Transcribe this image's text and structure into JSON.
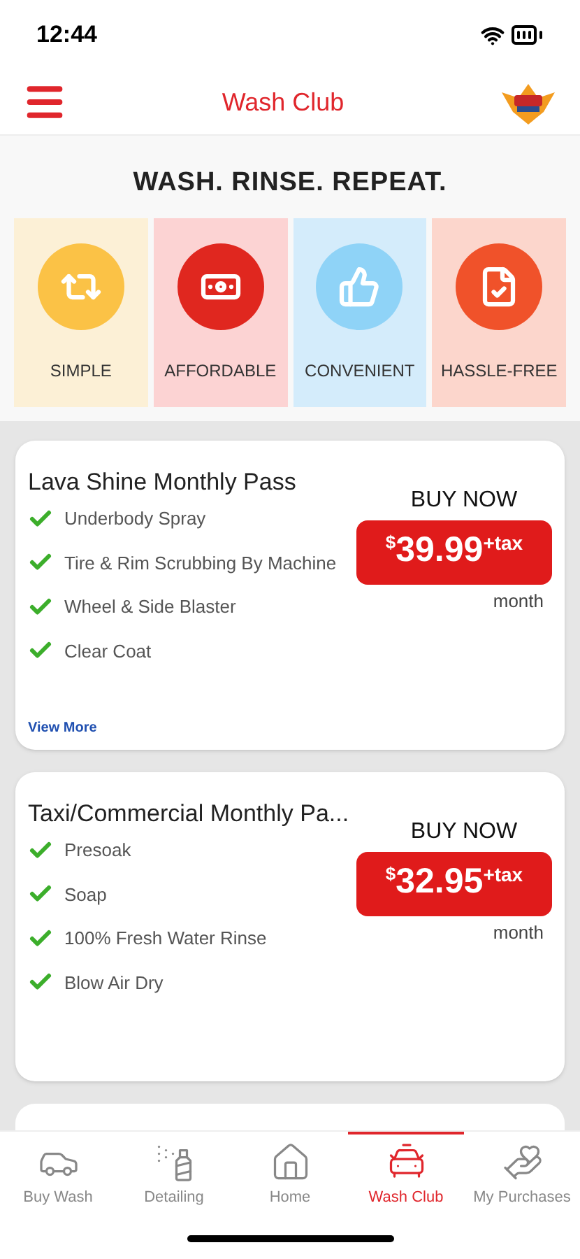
{
  "status_bar": {
    "time": "12:44"
  },
  "header": {
    "title": "Wash Club"
  },
  "tagline": "WASH. RINSE. REPEAT.",
  "features": [
    {
      "kind": "repeat",
      "label": "SIMPLE",
      "color": "#fbc246"
    },
    {
      "kind": "money",
      "label": "AFFORDABLE",
      "color": "#e0271f"
    },
    {
      "kind": "thumb",
      "label": "CONVENIENT",
      "color": "#8fd3f7"
    },
    {
      "kind": "certificate",
      "label": "HASSLE-FREE",
      "color": "#f0522a"
    }
  ],
  "plans": [
    {
      "name": "Lava Shine Monthly Pass",
      "items": [
        "Underbody Spray",
        "Tire & Rim Scrubbing By Machine",
        "Wheel & Side Blaster",
        "Clear Coat"
      ],
      "buy_label": "BUY NOW",
      "currency": "$",
      "amount": "39.99",
      "suffix": "+tax",
      "period": "month",
      "link": "View More"
    },
    {
      "name": "Taxi/Commercial Monthly Pa...",
      "items": [
        "Presoak",
        "Soap",
        "100% Fresh Water Rinse",
        "Blow Air Dry"
      ],
      "buy_label": "BUY NOW",
      "currency": "$",
      "amount": "32.95",
      "suffix": "+tax",
      "period": "month"
    }
  ],
  "tabs": [
    {
      "kind": "car",
      "label": "Buy Wash",
      "selected": false
    },
    {
      "kind": "detail",
      "label": "Detailing",
      "selected": false
    },
    {
      "kind": "home",
      "label": "Home",
      "selected": false
    },
    {
      "kind": "club",
      "label": "Wash Club",
      "selected": true
    },
    {
      "kind": "purchases",
      "label": "My Purchases",
      "selected": false
    }
  ]
}
